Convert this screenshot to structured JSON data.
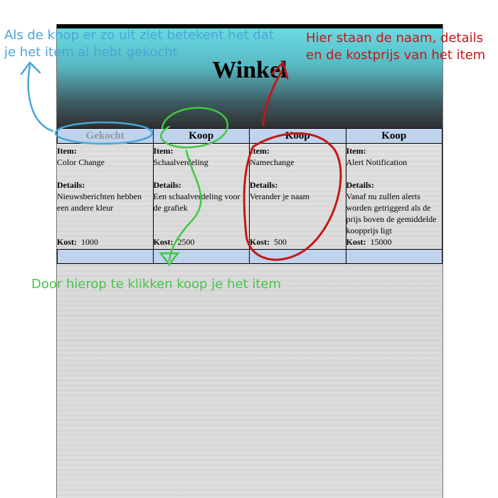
{
  "page": {
    "title": "Winkel"
  },
  "items": [
    {
      "button": "Gekocht",
      "state": "bought",
      "name": "Color Change",
      "details": "Nieuwsberichten hebben een andere kleur",
      "cost": "1000"
    },
    {
      "button": "Koop",
      "state": "buy",
      "name": "Schaalverdeling",
      "details": "Een schaalverdeling voor de grafiek",
      "cost": "2500"
    },
    {
      "button": "Koop",
      "state": "buy",
      "name": "Namechange",
      "details": "Verander je naam",
      "cost": "500"
    },
    {
      "button": "Koop",
      "state": "buy",
      "name": "Alert Notification",
      "details": "Vanaf nu zullen alerts worden getriggerd als de prijs boven de gemiddelde koopprijs ligt",
      "cost": "15000"
    }
  ],
  "labels": {
    "item": "Item:",
    "details": "Details:",
    "cost": "Kost:"
  },
  "annotations": {
    "blue": "Als de knop er zo uit ziet betekent het dat je het item al hebt gekocht",
    "red": "Hier staan de naam, details en de kostprijs van het item",
    "green": "Door hierop te klikken koop je het item"
  },
  "colors": {
    "header_top": "#69dbe1",
    "header_bottom": "#2f3031",
    "button_bg": "#c0d3ec",
    "annotation_blue": "#4aa5d8",
    "annotation_red": "#c41616",
    "annotation_green": "#46c648"
  }
}
